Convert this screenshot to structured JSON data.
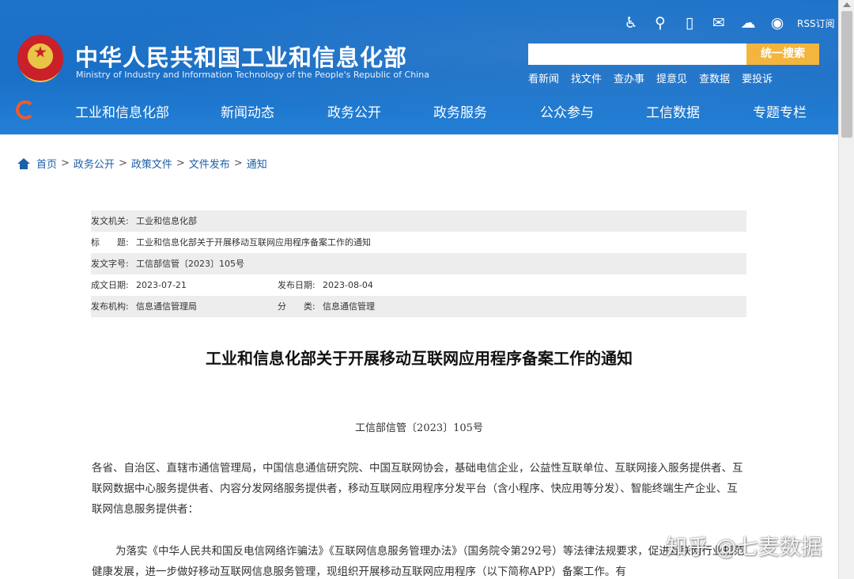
{
  "header": {
    "site_title": "中华人民共和国工业和信息化部",
    "site_subtitle": "Ministry of Industry and Information Technology of the People's Republic of China",
    "rss_label": "RSS订阅",
    "icons": [
      "accessibility-icon",
      "wheelchair-icon",
      "mobile-icon",
      "mail-icon",
      "wechat-icon",
      "weibo-icon"
    ],
    "search_placeholder": "",
    "search_button": "统一搜索",
    "quick_links": [
      "看新闻",
      "找文件",
      "查办事",
      "提意见",
      "查数据",
      "要投诉"
    ],
    "nav": [
      "工业和信息化部",
      "新闻动态",
      "政务公开",
      "政务服务",
      "公众参与",
      "工信数据",
      "专题专栏"
    ],
    "colors": {
      "header_blue": "#1a6fc6",
      "search_button": "#f3b53d"
    }
  },
  "breadcrumb": [
    "首页",
    "政务公开",
    "政策文件",
    "文件发布",
    "通知"
  ],
  "meta": {
    "issuer_label": "发文机关:",
    "issuer": "工业和信息化部",
    "title_label": "标　　题:",
    "title": "工业和信息化部关于开展移动互联网应用程序备案工作的通知",
    "doc_no_label": "发文字号:",
    "doc_no": "工信部信管〔2023〕105号",
    "created_label": "成文日期:",
    "created": "2023-07-21",
    "published_label": "发布日期:",
    "published": "2023-08-04",
    "agency_label": "发布机构:",
    "agency": "信息通信管理局",
    "category_label": "分　　类:",
    "category": "信息通信管理"
  },
  "document": {
    "title": "工业和信息化部关于开展移动互联网应用程序备案工作的通知",
    "number": "工信部信管〔2023〕105号",
    "para1": "各省、自治区、直辖市通信管理局，中国信息通信研究院、中国互联网协会，基础电信企业，公益性互联单位、互联网接入服务提供者、互联网数据中心服务提供者、内容分发网络服务提供者，移动互联网应用程序分发平台（含小程序、快应用等分发）、智能终端生产企业、互联网信息服务提供者：",
    "para2": "为落实《中华人民共和国反电信网络诈骗法》《互联网信息服务管理办法》（国务院令第292号）等法律法规要求，促进互联网行业规范健康发展，进一步做好移动互联网信息服务管理，现组织开展移动互联网应用程序（以下简称APP）备案工作。有"
  },
  "watermark": "知乎 @七麦数据"
}
